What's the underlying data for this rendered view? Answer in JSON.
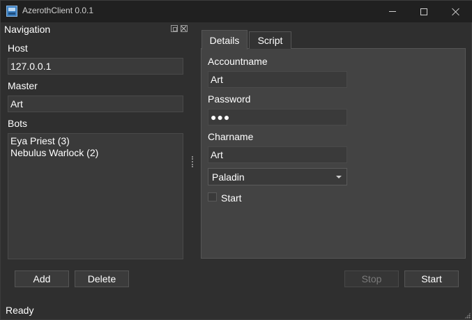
{
  "window": {
    "title": "AzerothClient 0.0.1"
  },
  "navigation": {
    "title": "Navigation",
    "host_label": "Host",
    "host_value": "127.0.0.1",
    "master_label": "Master",
    "master_value": "Art",
    "bots_label": "Bots",
    "bots": [
      "Eya Priest (3)",
      "Nebulus Warlock (2)"
    ],
    "add_label": "Add",
    "delete_label": "Delete"
  },
  "tabs": [
    {
      "label": "Details",
      "selected": true
    },
    {
      "label": "Script",
      "selected": false
    }
  ],
  "details": {
    "accountname_label": "Accountname",
    "accountname_value": "Art",
    "password_label": "Password",
    "password_value": "●●●",
    "charname_label": "Charname",
    "charname_value": "Art",
    "class_value": "Paladin",
    "start_checkbox_label": "Start",
    "start_checked": false
  },
  "actions": {
    "stop_label": "Stop",
    "start_label": "Start"
  },
  "status": {
    "text": "Ready"
  },
  "colors": {
    "background": "#2f2f2f",
    "titlebar": "#202020",
    "panel": "#434343",
    "field": "#3a3a3a"
  }
}
